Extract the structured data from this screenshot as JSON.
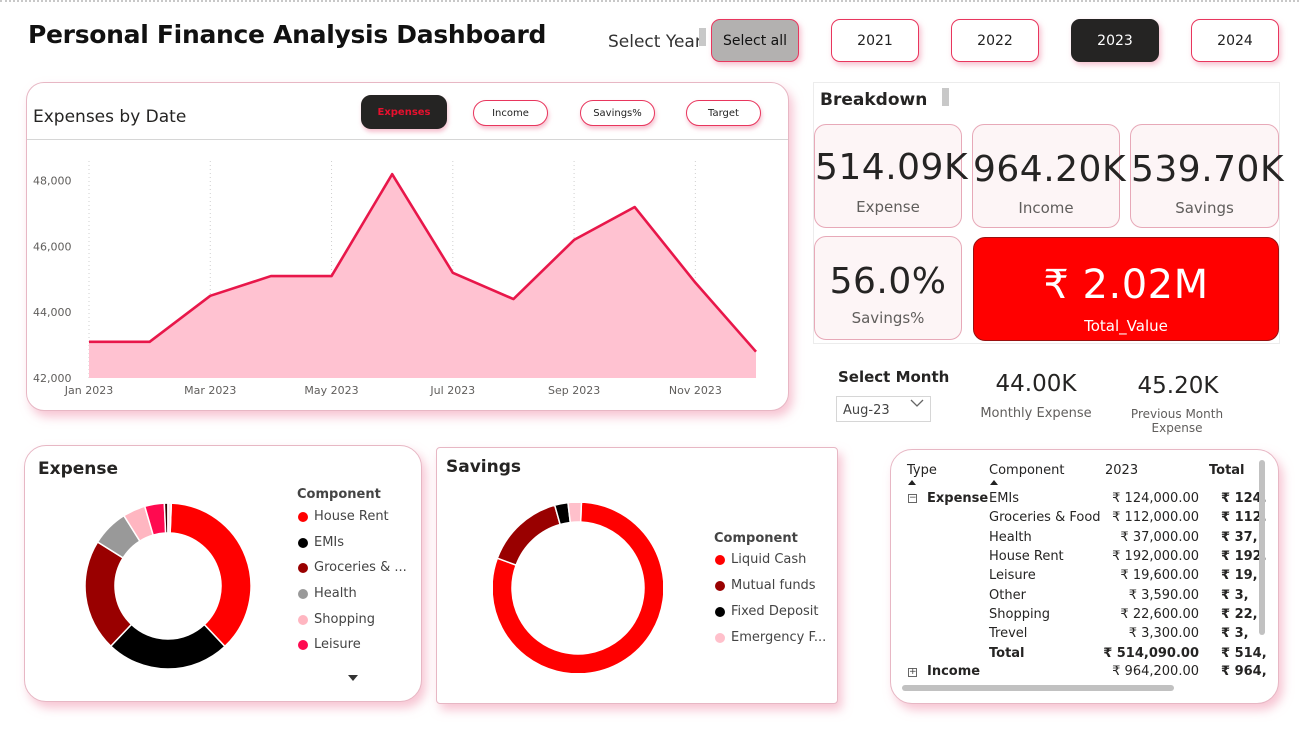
{
  "title": "Personal Finance Analysis Dashboard",
  "year_filter": {
    "label": "Select Year",
    "buttons": [
      "Select all",
      "2021",
      "2022",
      "2023",
      "2024"
    ],
    "selected": "2023"
  },
  "line_chart": {
    "title": "Expenses by Date",
    "metric_buttons": [
      "Expenses",
      "Income",
      "Savings%",
      "Target"
    ],
    "active_metric": "Expenses",
    "colors": {
      "line": "#e8174a",
      "fill": "#ffc2d1"
    }
  },
  "chart_data": {
    "type": "area",
    "x": [
      "Jan 2023",
      "Feb 2023",
      "Mar 2023",
      "Apr 2023",
      "May 2023",
      "Jun 2023",
      "Jul 2023",
      "Aug 2023",
      "Sep 2023",
      "Oct 2023",
      "Nov 2023",
      "Dec 2023"
    ],
    "x_tick_labels": [
      "Jan 2023",
      "Mar 2023",
      "May 2023",
      "Jul 2023",
      "Sep 2023",
      "Nov 2023"
    ],
    "values": [
      43100,
      43100,
      44500,
      45100,
      45100,
      48200,
      45200,
      44400,
      46200,
      47200,
      44900,
      42800
    ],
    "y_tick_labels": [
      "42,000",
      "44,000",
      "46,000",
      "48,000"
    ],
    "ylim": [
      42000,
      48600
    ],
    "grid": "vertical dotted"
  },
  "breakdown": {
    "title": "Breakdown",
    "expense": {
      "value": "514.09K",
      "label": "Expense"
    },
    "income": {
      "value": "964.20K",
      "label": "Income"
    },
    "savings": {
      "value": "539.70K",
      "label": "Savings"
    },
    "savings_pct": {
      "value": "56.0%",
      "label": "Savings%"
    },
    "total": {
      "value": "₹ 2.02M",
      "label": "Total_Value"
    }
  },
  "month": {
    "title": "Select Month",
    "selected": "Aug-23",
    "monthly_expense": {
      "value": "44.00K",
      "label": "Monthly Expense"
    },
    "previous_expense": {
      "value": "45.20K",
      "label": "Previous Month Expense"
    }
  },
  "expense_donut": {
    "title": "Expense",
    "legend_title": "Component",
    "legend_items": [
      "House Rent",
      "EMIs",
      "Groceries & ...",
      "Health",
      "Shopping",
      "Leisure"
    ],
    "segments": [
      {
        "name": "House Rent",
        "value": 192000,
        "color": "#ff0000"
      },
      {
        "name": "EMIs",
        "value": 124000,
        "color": "#000000"
      },
      {
        "name": "Groceries & Food",
        "value": 112000,
        "color": "#990000"
      },
      {
        "name": "Health",
        "value": 37000,
        "color": "#999999"
      },
      {
        "name": "Shopping",
        "value": 22600,
        "color": "#ffb6c1"
      },
      {
        "name": "Leisure",
        "value": 19600,
        "color": "#ff0a50"
      },
      {
        "name": "Other",
        "value": 3590,
        "color": "#330000"
      },
      {
        "name": "Trevel",
        "value": 3300,
        "color": "#ffe0e6"
      }
    ]
  },
  "savings_donut": {
    "title": "Savings",
    "legend_title": "Component",
    "legend_items": [
      "Liquid Cash",
      "Mutual funds",
      "Fixed Deposit",
      "Emergency F..."
    ],
    "segments": [
      {
        "name": "Liquid Cash",
        "value": 80,
        "color": "#ff0000"
      },
      {
        "name": "Mutual funds",
        "value": 15,
        "color": "#990000"
      },
      {
        "name": "Fixed Deposit",
        "value": 2.5,
        "color": "#000000"
      },
      {
        "name": "Emergency Fund",
        "value": 2.5,
        "color": "#ffc0cb"
      }
    ]
  },
  "table": {
    "headers": [
      "Type",
      "Component",
      "2023",
      "Total"
    ],
    "group_expense": "Expense",
    "group_income": "Income",
    "rows": [
      {
        "component": "EMIs",
        "value": "₹ 124,000.00",
        "total": "₹ 124,"
      },
      {
        "component": "Groceries & Food",
        "value": "₹ 112,000.00",
        "total": "₹ 112,"
      },
      {
        "component": "Health",
        "value": "₹ 37,000.00",
        "total": "₹ 37,"
      },
      {
        "component": "House Rent",
        "value": "₹ 192,000.00",
        "total": "₹ 192,"
      },
      {
        "component": "Leisure",
        "value": "₹ 19,600.00",
        "total": "₹ 19,"
      },
      {
        "component": "Other",
        "value": "₹ 3,590.00",
        "total": "₹ 3,"
      },
      {
        "component": "Shopping",
        "value": "₹ 22,600.00",
        "total": "₹ 22,"
      },
      {
        "component": "Trevel",
        "value": "₹ 3,300.00",
        "total": "₹ 3,"
      }
    ],
    "subtotal": {
      "label": "Total",
      "value": "₹ 514,090.00",
      "total": "₹ 514,"
    },
    "income_row": {
      "value": "₹ 964,200.00",
      "total": "₹ 964,"
    }
  }
}
